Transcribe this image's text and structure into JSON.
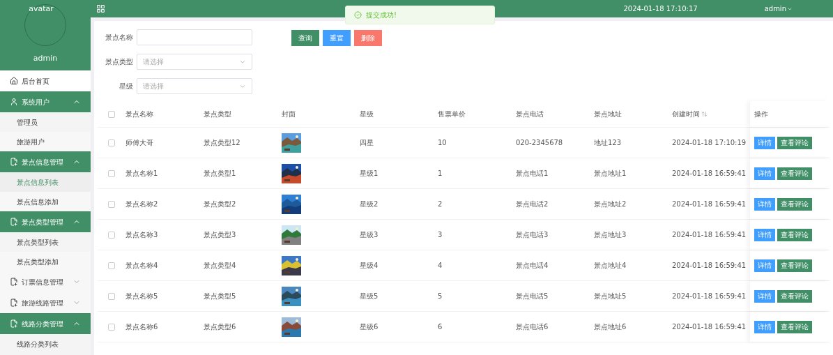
{
  "sidebar": {
    "avatar_alt": "avatar",
    "username": "admin",
    "menu": [
      {
        "label": "后台首页",
        "kind": "link"
      },
      {
        "label": "系统用户",
        "kind": "group",
        "expanded": true,
        "children": [
          {
            "label": "管理员",
            "selected": false
          },
          {
            "label": "旅游用户",
            "selected": false
          }
        ]
      },
      {
        "label": "景点信息管理",
        "kind": "group",
        "expanded": true,
        "children": [
          {
            "label": "景点信息列表",
            "selected": true
          },
          {
            "label": "景点信息添加",
            "selected": false
          }
        ]
      },
      {
        "label": "景点类型管理",
        "kind": "group",
        "expanded": true,
        "children": [
          {
            "label": "景点类型列表",
            "selected": false
          },
          {
            "label": "景点类型添加",
            "selected": false
          }
        ]
      },
      {
        "label": "订票信息管理",
        "kind": "group",
        "expanded": false
      },
      {
        "label": "旅游线路管理",
        "kind": "group",
        "expanded": false
      },
      {
        "label": "线路分类管理",
        "kind": "group",
        "expanded": true,
        "children": [
          {
            "label": "线路分类列表",
            "selected": false
          }
        ]
      }
    ]
  },
  "header": {
    "datetime": "2024-01-18 17:10:17",
    "user": "admin"
  },
  "toast": {
    "message": "提交成功!"
  },
  "filters": [
    {
      "label": "景点名称",
      "kind": "input"
    },
    {
      "label": "景点类型",
      "kind": "select",
      "placeholder": "请选择"
    },
    {
      "label": "星级",
      "kind": "select",
      "placeholder": "请选择"
    }
  ],
  "filter_buttons": [
    {
      "label": "查询",
      "kind": "primary"
    },
    {
      "label": "重置",
      "kind": "info"
    },
    {
      "label": "删除",
      "kind": "danger"
    }
  ],
  "table": {
    "all_checked": false,
    "columns": [
      "景点名称",
      "景点类型",
      "封面",
      "星级",
      "售票单价",
      "景点电话",
      "景点地址",
      "创建时间",
      "操作"
    ],
    "rows": [
      {
        "checked": false,
        "name": "师傅大哥",
        "type": "景点类型12",
        "star": "四星",
        "price": "10",
        "phone": "020-2345678",
        "address": "地址123",
        "created": "2024-01-18 17:10:19",
        "actions": [
          "详情",
          "查看评论"
        ]
      },
      {
        "checked": false,
        "name": "景点名称1",
        "type": "景点类型1",
        "star": "星级1",
        "price": "1",
        "phone": "景点电话1",
        "address": "景点地址1",
        "created": "2024-01-18 16:59:41",
        "actions": [
          "详情",
          "查看评论"
        ]
      },
      {
        "checked": false,
        "name": "景点名称2",
        "type": "景点类型2",
        "star": "星级2",
        "price": "2",
        "phone": "景点电话2",
        "address": "景点地址2",
        "created": "2024-01-18 16:59:41",
        "actions": [
          "详情",
          "查看评论"
        ]
      },
      {
        "checked": false,
        "name": "景点名称3",
        "type": "景点类型3",
        "star": "星级3",
        "price": "3",
        "phone": "景点电话3",
        "address": "景点地址3",
        "created": "2024-01-18 16:59:41",
        "actions": [
          "详情",
          "查看评论"
        ]
      },
      {
        "checked": false,
        "name": "景点名称4",
        "type": "景点类型4",
        "star": "星级4",
        "price": "4",
        "phone": "景点电话4",
        "address": "景点地址4",
        "created": "2024-01-18 16:59:41",
        "actions": [
          "详情",
          "查看评论"
        ]
      },
      {
        "checked": false,
        "name": "景点名称5",
        "type": "景点类型5",
        "star": "星级5",
        "price": "5",
        "phone": "景点电话5",
        "address": "景点地址5",
        "created": "2024-01-18 16:59:41",
        "actions": [
          "详情",
          "查看评论"
        ]
      },
      {
        "checked": false,
        "name": "景点名称6",
        "type": "景点类型6",
        "star": "星级6",
        "price": "6",
        "phone": "景点电话6",
        "address": "景点地址6",
        "created": "2024-01-18 16:59:41",
        "actions": [
          "详情",
          "查看评论"
        ]
      }
    ]
  }
}
